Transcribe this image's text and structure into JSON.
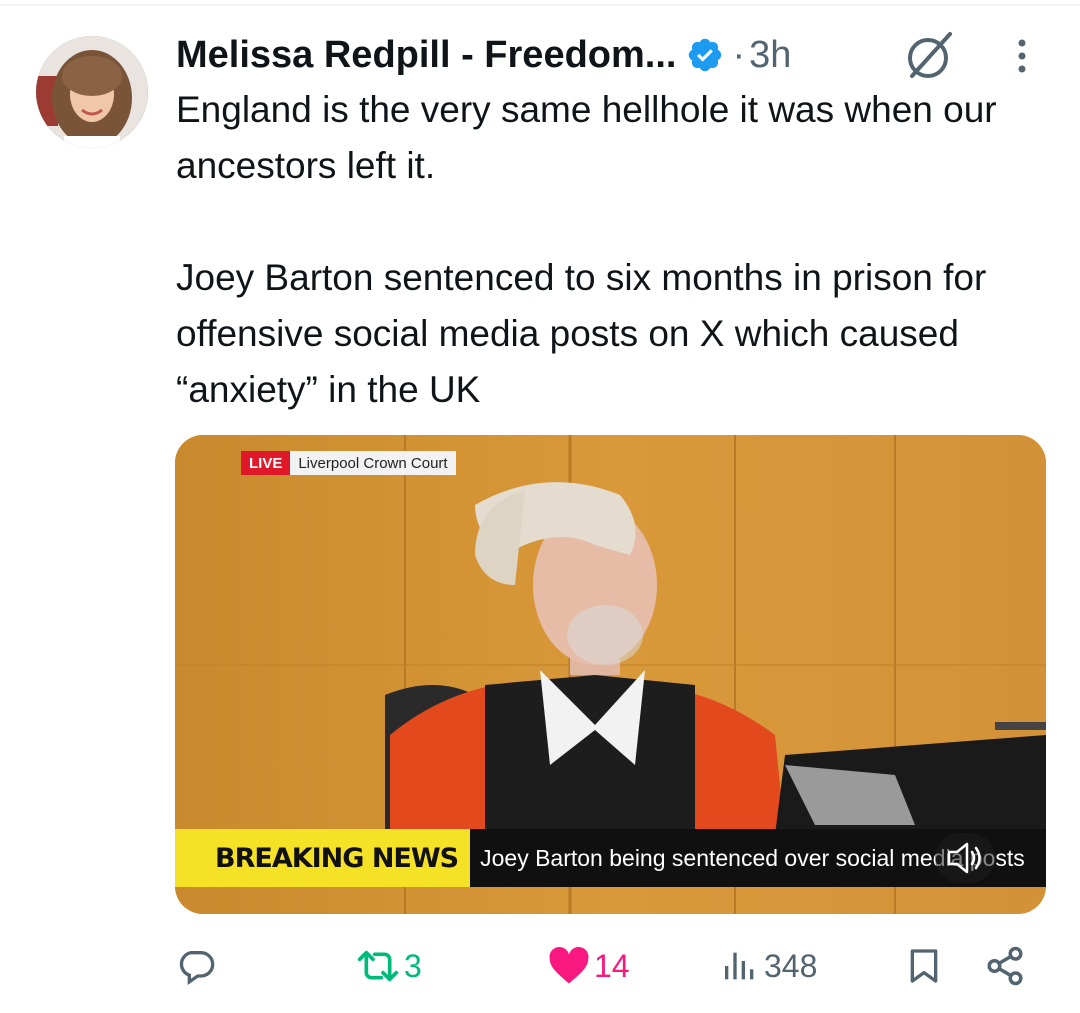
{
  "author": {
    "name": "Melissa Redpill - Freedom...",
    "verified": true,
    "separator": "·",
    "time": "3h"
  },
  "tweet": {
    "paragraph1": "England is the very same hellhole it was when our ancestors left it.",
    "paragraph2": "Joey Barton sentenced to six months in prison for offensive social media posts on X which caused “anxiety” in the UK"
  },
  "media": {
    "live_label": "LIVE",
    "location_label": "Liverpool Crown Court",
    "breaking_label": "BREAKING NEWS",
    "headline": "Joey Barton being sentenced over social media posts"
  },
  "actions": {
    "reply_count": "",
    "retweet_count": "3",
    "like_count": "14",
    "views_count": "348"
  },
  "colors": {
    "verified_blue": "#1d9bf0",
    "retweet_green": "#00ba7c",
    "like_pink": "#f91880",
    "muted_gray": "#536471",
    "breaking_yellow": "#f5e125",
    "live_red": "#e0192a"
  },
  "icons": [
    "grok-icon",
    "more-icon",
    "reply-icon",
    "retweet-icon",
    "heart-icon",
    "views-icon",
    "bookmark-icon",
    "share-icon",
    "volume-icon",
    "verified-icon"
  ]
}
